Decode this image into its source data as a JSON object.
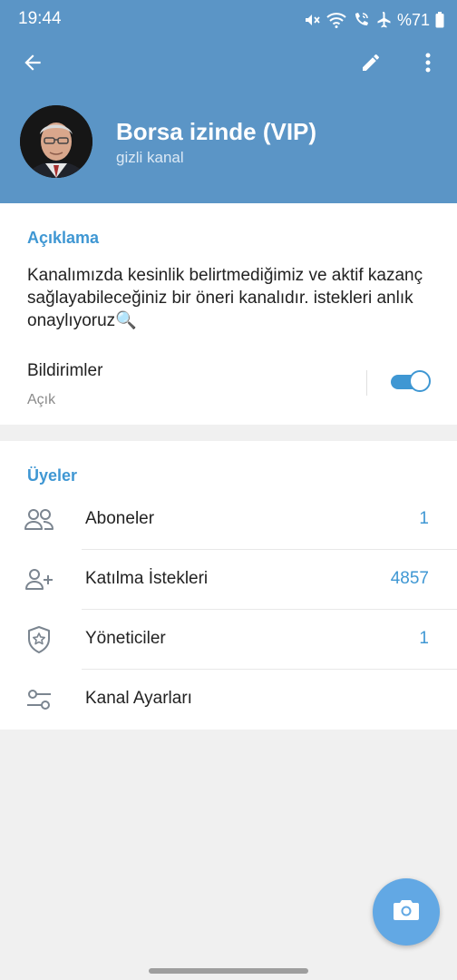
{
  "status_bar": {
    "time": "19:44",
    "battery": "%71",
    "icons": [
      "mute-icon",
      "wifi-icon",
      "wifi-calling-icon",
      "airplane-icon",
      "battery-icon"
    ]
  },
  "toolbar": {
    "back_icon": "arrow-left-icon",
    "edit_icon": "pencil-icon",
    "more_icon": "more-vertical-icon"
  },
  "channel": {
    "title": "Borsa izinde (VIP)",
    "subtitle": "gizli kanal"
  },
  "description_section": {
    "header": "Açıklama",
    "text": "Kanalımızda kesinlik belirtmediğimiz ve aktif kazanç sağlayabileceğiniz bir öneri kanalıdır. istekleri anlık onaylıyoruz🔍"
  },
  "notifications": {
    "label": "Bildirimler",
    "status": "Açık",
    "enabled": true
  },
  "members_section": {
    "header": "Üyeler",
    "rows": [
      {
        "label": "Aboneler",
        "value": "1",
        "icon": "people-icon"
      },
      {
        "label": "Katılma İstekleri",
        "value": "4857",
        "icon": "add-person-icon"
      },
      {
        "label": "Yöneticiler",
        "value": "1",
        "icon": "admin-shield-icon"
      },
      {
        "label": "Kanal Ayarları",
        "value": "",
        "icon": "settings-sliders-icon"
      }
    ]
  },
  "fab": {
    "icon": "camera-icon"
  },
  "colors": {
    "header_bg": "#5b95c6",
    "accent": "#3f97d3",
    "fab": "#62a8e4"
  }
}
